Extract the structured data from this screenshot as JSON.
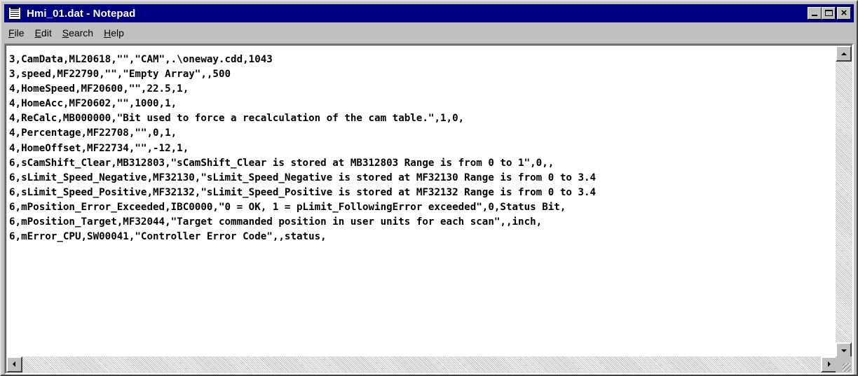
{
  "window": {
    "title": "Hmi_01.dat - Notepad",
    "accent_color": "#000080"
  },
  "titlebar_buttons": {
    "minimize_icon": "minimize-icon",
    "maximize_icon": "maximize-icon",
    "close_label": "×"
  },
  "menu": [
    {
      "first": "F",
      "rest": "ile"
    },
    {
      "first": "E",
      "rest": "dit"
    },
    {
      "first": "S",
      "rest": "earch"
    },
    {
      "first": "H",
      "rest": "elp"
    }
  ],
  "document": {
    "lines": [
      "3,CamData,ML20618,\"\",\"CAM\",.\\oneway.cdd,1043",
      "3,speed,MF22790,\"\",\"Empty Array\",,500",
      "4,HomeSpeed,MF20600,\"\",22.5,1,",
      "4,HomeAcc,MF20602,\"\",1000,1,",
      "4,ReCalc,MB000000,\"Bit used to force a recalculation of the cam table.\",1,0,",
      "4,Percentage,MF22708,\"\",0,1,",
      "4,HomeOffset,MF22734,\"\",-12,1,",
      "6,sCamShift_Clear,MB312803,\"sCamShift_Clear is stored at MB312803 Range is from 0 to 1\",0,,",
      "6,sLimit_Speed_Negative,MF32130,\"sLimit_Speed_Negative is stored at MF32130 Range is from 0 to 3.4",
      "6,sLimit_Speed_Positive,MF32132,\"sLimit_Speed_Positive is stored at MF32132 Range is from 0 to 3.4",
      "6,mPosition_Error_Exceeded,IBC0000,\"0 = OK, 1 = pLimit_FollowingError exceeded\",0,Status Bit,",
      "6,mPosition_Target,MF32044,\"Target commanded position in user units for each scan\",,inch,",
      "6,mError_CPU,SW00041,\"Controller Error Code\",,status,"
    ]
  }
}
